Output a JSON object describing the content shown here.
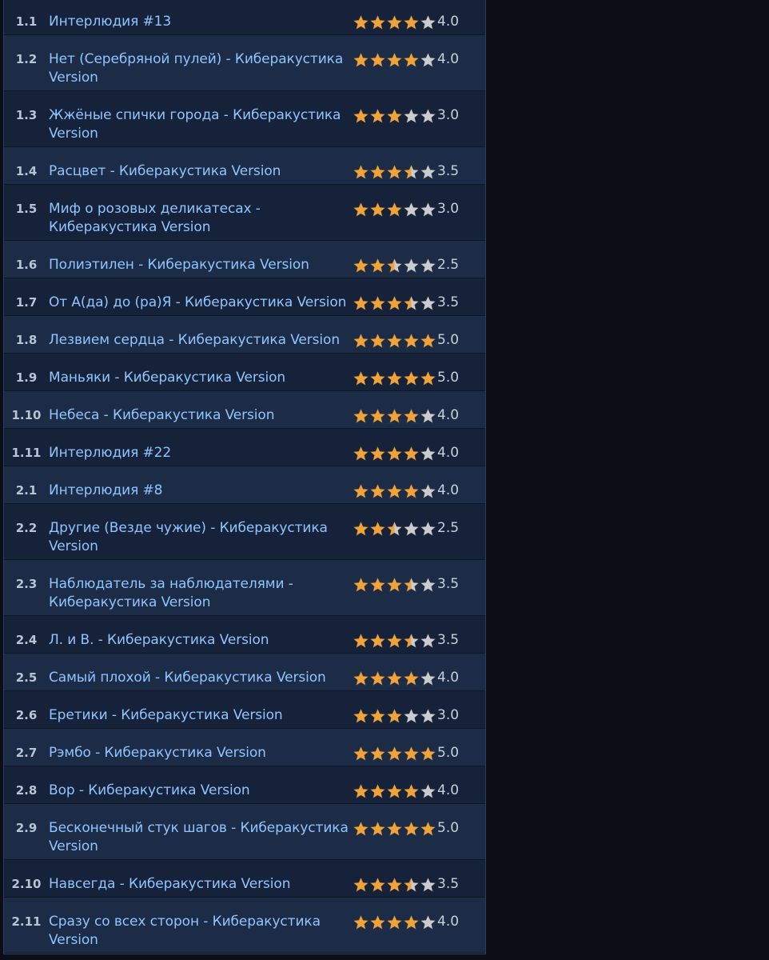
{
  "colors": {
    "star_filled": "#f0a33a",
    "star_empty": "#c9cdd3",
    "link": "#8fc4ff",
    "row_odd": "#16223a",
    "row_even": "#1c2c47"
  },
  "tracks": [
    {
      "num": "1.1",
      "title": "Интерлюдия #13",
      "rating": 4.0,
      "rating_text": "4.0"
    },
    {
      "num": "1.2",
      "title": "Нет (Серебряной пулей) - Киберакустика Version",
      "rating": 4.0,
      "rating_text": "4.0"
    },
    {
      "num": "1.3",
      "title": "Жжёные спички города - Киберакустика Version",
      "rating": 3.0,
      "rating_text": "3.0"
    },
    {
      "num": "1.4",
      "title": "Расцвет - Киберакустика Version",
      "rating": 3.5,
      "rating_text": "3.5"
    },
    {
      "num": "1.5",
      "title": "Миф о розовых деликатесах - Киберакустика Version",
      "rating": 3.0,
      "rating_text": "3.0"
    },
    {
      "num": "1.6",
      "title": "Полиэтилен - Киберакустика Version",
      "rating": 2.5,
      "rating_text": "2.5"
    },
    {
      "num": "1.7",
      "title": "От А(да) до (ра)Я - Киберакустика Version",
      "rating": 3.5,
      "rating_text": "3.5"
    },
    {
      "num": "1.8",
      "title": "Лезвием сердца - Киберакустика Version",
      "rating": 5.0,
      "rating_text": "5.0"
    },
    {
      "num": "1.9",
      "title": "Маньяки - Киберакустика Version",
      "rating": 5.0,
      "rating_text": "5.0"
    },
    {
      "num": "1.10",
      "title": "Небеса - Киберакустика Version",
      "rating": 4.0,
      "rating_text": "4.0"
    },
    {
      "num": "1.11",
      "title": "Интерлюдия #22",
      "rating": 4.0,
      "rating_text": "4.0"
    },
    {
      "num": "2.1",
      "title": "Интерлюдия #8",
      "rating": 4.0,
      "rating_text": "4.0"
    },
    {
      "num": "2.2",
      "title": "Другие (Везде чужие) - Киберакустика Version",
      "rating": 2.5,
      "rating_text": "2.5"
    },
    {
      "num": "2.3",
      "title": "Наблюдатель за наблюдателями - Киберакустика Version",
      "rating": 3.5,
      "rating_text": "3.5"
    },
    {
      "num": "2.4",
      "title": "Л. и В. - Киберакустика Version",
      "rating": 3.5,
      "rating_text": "3.5"
    },
    {
      "num": "2.5",
      "title": "Самый плохой - Киберакустика Version",
      "rating": 4.0,
      "rating_text": "4.0"
    },
    {
      "num": "2.6",
      "title": "Еретики - Киберакустика Version",
      "rating": 3.0,
      "rating_text": "3.0"
    },
    {
      "num": "2.7",
      "title": "Рэмбо - Киберакустика Version",
      "rating": 5.0,
      "rating_text": "5.0"
    },
    {
      "num": "2.8",
      "title": "Вор - Киберакустика Version",
      "rating": 4.0,
      "rating_text": "4.0"
    },
    {
      "num": "2.9",
      "title": "Бесконечный стук шагов - Киберакустика Version",
      "rating": 5.0,
      "rating_text": "5.0"
    },
    {
      "num": "2.10",
      "title": "Навсегда - Киберакустика Version",
      "rating": 3.5,
      "rating_text": "3.5"
    },
    {
      "num": "2.11",
      "title": "Сразу со всех сторон - Киберакустика Version",
      "rating": 4.0,
      "rating_text": "4.0"
    }
  ]
}
